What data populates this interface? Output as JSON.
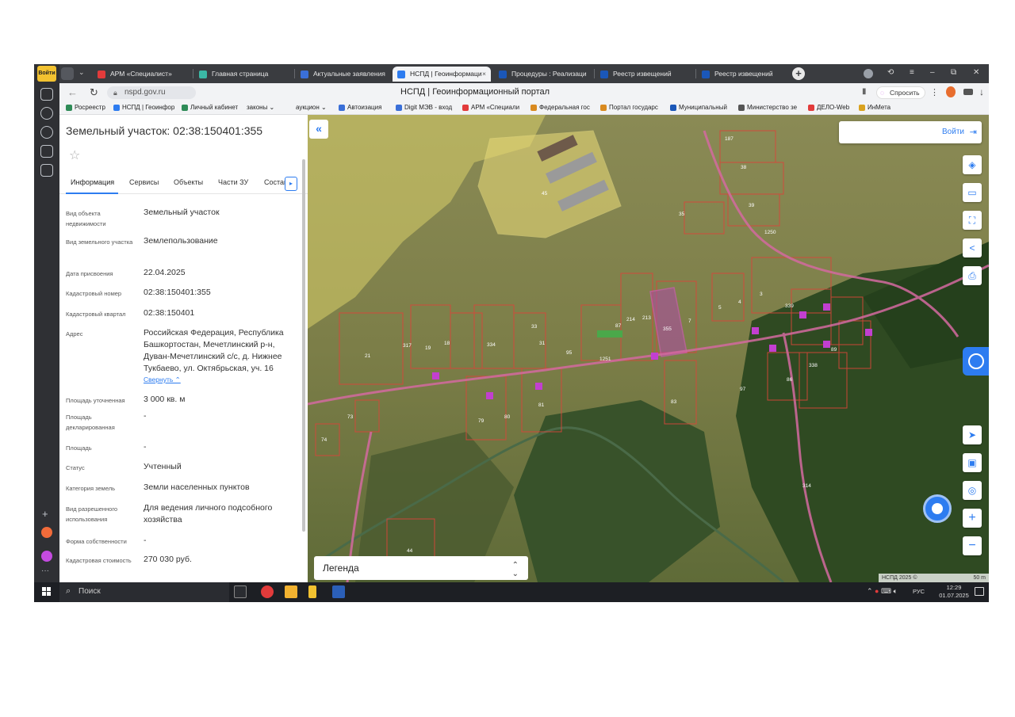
{
  "browser": {
    "tabs": [
      {
        "label": "АРМ «Специалист»",
        "favicon_color": "#e23b3b"
      },
      {
        "label": "Главная страница",
        "favicon_color": "#3bb8a5"
      },
      {
        "label": "Актуальные заявления",
        "favicon_color": "#3a6fd8"
      },
      {
        "label": "НСПД | Геоинформаци",
        "favicon_color": "#2d7cf0",
        "active": true
      },
      {
        "label": "Процедуры : Реализаци",
        "favicon_color": "#1b57b8"
      },
      {
        "label": "Реестр извещений",
        "favicon_color": "#1b57b8"
      },
      {
        "label": "Реестр извещений",
        "favicon_color": "#1b57b8"
      }
    ],
    "yandex_badge": "Войти",
    "url": "nspd.gov.ru",
    "page_title": "НСПД | Геоинформационный портал",
    "ask_label": "Спросить",
    "bookmarks": [
      {
        "label": "Росреестр",
        "color": "#2e8b57"
      },
      {
        "label": "НСПД | Геоинфор",
        "color": "#2d7cf0"
      },
      {
        "label": "Личный кабинет",
        "color": "#2e8b57"
      },
      {
        "label": "законы ⌄",
        "color": "#f2f3f5"
      },
      {
        "label": "аукцион ⌄",
        "color": "#f2f3f5"
      },
      {
        "label": "Автоизация",
        "color": "#3a6fd8"
      },
      {
        "label": "Digit МЭВ - вход",
        "color": "#3a6fd8"
      },
      {
        "label": "АРМ «Специали",
        "color": "#e23b3b"
      },
      {
        "label": "Федеральная гос",
        "color": "#d98a1f"
      },
      {
        "label": "Портал государс",
        "color": "#d98a1f"
      },
      {
        "label": "Муниципальный",
        "color": "#1b57b8"
      },
      {
        "label": "Министерство зе",
        "color": "#555555"
      },
      {
        "label": "ДЕЛО-Web",
        "color": "#e23b3b"
      },
      {
        "label": "ИнМета",
        "color": "#d9a21f"
      }
    ]
  },
  "panel": {
    "title": "Земельный участок: 02:38:150401:355",
    "tabs": [
      "Информация",
      "Сервисы",
      "Объекты",
      "Части ЗУ",
      "Состав"
    ],
    "collapse_label": "Свернуть ⌃",
    "rows": [
      {
        "label": "Вид объекта недвижимости",
        "value": "Земельный участок"
      },
      {
        "label": "Вид земельного участка",
        "value": "Землепользование"
      },
      {
        "label": "Дата присвоения",
        "value": "22.04.2025"
      },
      {
        "label": "Кадастровый номер",
        "value": "02:38:150401:355"
      },
      {
        "label": "Кадастровый квартал",
        "value": "02:38:150401"
      },
      {
        "label": "Адрес",
        "value": "Российская Федерация, Республика Башкортостан, Мечетлинский р-н, Дуван-Мечетлинский с/с, д. Нижнее Тукбаево, ул. Октябрьская, уч. 16"
      },
      {
        "label": "Площадь уточненная",
        "value": "3 000 кв. м"
      },
      {
        "label": "Площадь декларированная",
        "value": "-"
      },
      {
        "label": "Площадь",
        "value": "-"
      },
      {
        "label": "Статус",
        "value": "Учтенный"
      },
      {
        "label": "Категория земель",
        "value": "Земли населенных пунктов"
      },
      {
        "label": "Вид разрешенного использования",
        "value": "Для ведения личного подсобного хозяйства"
      },
      {
        "label": "Форма собственности",
        "value": "-"
      },
      {
        "label": "Кадастровая стоимость",
        "value": "270 030 руб."
      }
    ]
  },
  "map": {
    "login_label": "Войти",
    "legend_label": "Легенда",
    "attribution": "НСПД 2025 ©",
    "scale": "50 m",
    "plot_labels": [
      "187",
      "38",
      "39",
      "35",
      "1250",
      "45",
      "5",
      "4",
      "3",
      "339",
      "87",
      "214",
      "213",
      "355",
      "7",
      "95",
      "334",
      "33",
      "31",
      "21",
      "317",
      "19",
      "18",
      "1251",
      "97",
      "86",
      "338",
      "89",
      "81",
      "79",
      "80",
      "73",
      "74",
      "314",
      "44",
      "83"
    ]
  },
  "taskbar": {
    "search_label": "Поиск",
    "lang": "РУС",
    "time": "12:29",
    "date": "01.07.2025"
  }
}
